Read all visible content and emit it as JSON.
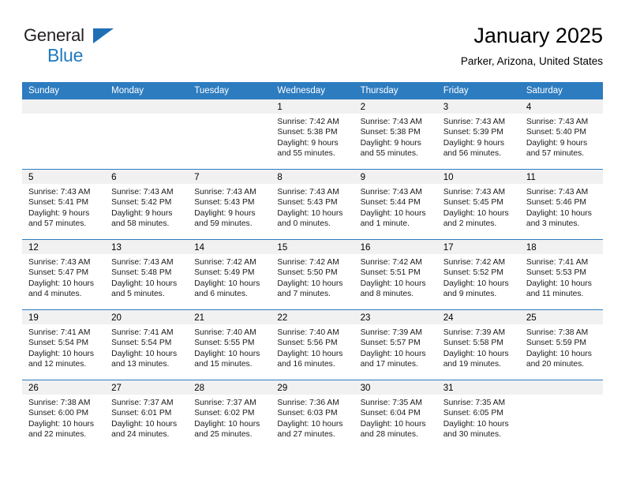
{
  "brand": {
    "line1": "General",
    "line2": "Blue",
    "triangle_color": "#1f6fb5",
    "line2_color": "#1f7ac0"
  },
  "header": {
    "title": "January 2025",
    "subtitle": "Parker, Arizona, United States"
  },
  "theme": {
    "header_blue": "#2d7cc0",
    "day_band_gray": "#f1f1f1",
    "text_color": "#1a1a1a"
  },
  "calendar": {
    "weekdays": [
      "Sunday",
      "Monday",
      "Tuesday",
      "Wednesday",
      "Thursday",
      "Friday",
      "Saturday"
    ],
    "weeks": [
      [
        {
          "day": "",
          "lines": []
        },
        {
          "day": "",
          "lines": []
        },
        {
          "day": "",
          "lines": []
        },
        {
          "day": "1",
          "lines": [
            "Sunrise: 7:42 AM",
            "Sunset: 5:38 PM",
            "Daylight: 9 hours",
            "and 55 minutes."
          ]
        },
        {
          "day": "2",
          "lines": [
            "Sunrise: 7:43 AM",
            "Sunset: 5:38 PM",
            "Daylight: 9 hours",
            "and 55 minutes."
          ]
        },
        {
          "day": "3",
          "lines": [
            "Sunrise: 7:43 AM",
            "Sunset: 5:39 PM",
            "Daylight: 9 hours",
            "and 56 minutes."
          ]
        },
        {
          "day": "4",
          "lines": [
            "Sunrise: 7:43 AM",
            "Sunset: 5:40 PM",
            "Daylight: 9 hours",
            "and 57 minutes."
          ]
        }
      ],
      [
        {
          "day": "5",
          "lines": [
            "Sunrise: 7:43 AM",
            "Sunset: 5:41 PM",
            "Daylight: 9 hours",
            "and 57 minutes."
          ]
        },
        {
          "day": "6",
          "lines": [
            "Sunrise: 7:43 AM",
            "Sunset: 5:42 PM",
            "Daylight: 9 hours",
            "and 58 minutes."
          ]
        },
        {
          "day": "7",
          "lines": [
            "Sunrise: 7:43 AM",
            "Sunset: 5:43 PM",
            "Daylight: 9 hours",
            "and 59 minutes."
          ]
        },
        {
          "day": "8",
          "lines": [
            "Sunrise: 7:43 AM",
            "Sunset: 5:43 PM",
            "Daylight: 10 hours",
            "and 0 minutes."
          ]
        },
        {
          "day": "9",
          "lines": [
            "Sunrise: 7:43 AM",
            "Sunset: 5:44 PM",
            "Daylight: 10 hours",
            "and 1 minute."
          ]
        },
        {
          "day": "10",
          "lines": [
            "Sunrise: 7:43 AM",
            "Sunset: 5:45 PM",
            "Daylight: 10 hours",
            "and 2 minutes."
          ]
        },
        {
          "day": "11",
          "lines": [
            "Sunrise: 7:43 AM",
            "Sunset: 5:46 PM",
            "Daylight: 10 hours",
            "and 3 minutes."
          ]
        }
      ],
      [
        {
          "day": "12",
          "lines": [
            "Sunrise: 7:43 AM",
            "Sunset: 5:47 PM",
            "Daylight: 10 hours",
            "and 4 minutes."
          ]
        },
        {
          "day": "13",
          "lines": [
            "Sunrise: 7:43 AM",
            "Sunset: 5:48 PM",
            "Daylight: 10 hours",
            "and 5 minutes."
          ]
        },
        {
          "day": "14",
          "lines": [
            "Sunrise: 7:42 AM",
            "Sunset: 5:49 PM",
            "Daylight: 10 hours",
            "and 6 minutes."
          ]
        },
        {
          "day": "15",
          "lines": [
            "Sunrise: 7:42 AM",
            "Sunset: 5:50 PM",
            "Daylight: 10 hours",
            "and 7 minutes."
          ]
        },
        {
          "day": "16",
          "lines": [
            "Sunrise: 7:42 AM",
            "Sunset: 5:51 PM",
            "Daylight: 10 hours",
            "and 8 minutes."
          ]
        },
        {
          "day": "17",
          "lines": [
            "Sunrise: 7:42 AM",
            "Sunset: 5:52 PM",
            "Daylight: 10 hours",
            "and 9 minutes."
          ]
        },
        {
          "day": "18",
          "lines": [
            "Sunrise: 7:41 AM",
            "Sunset: 5:53 PM",
            "Daylight: 10 hours",
            "and 11 minutes."
          ]
        }
      ],
      [
        {
          "day": "19",
          "lines": [
            "Sunrise: 7:41 AM",
            "Sunset: 5:54 PM",
            "Daylight: 10 hours",
            "and 12 minutes."
          ]
        },
        {
          "day": "20",
          "lines": [
            "Sunrise: 7:41 AM",
            "Sunset: 5:54 PM",
            "Daylight: 10 hours",
            "and 13 minutes."
          ]
        },
        {
          "day": "21",
          "lines": [
            "Sunrise: 7:40 AM",
            "Sunset: 5:55 PM",
            "Daylight: 10 hours",
            "and 15 minutes."
          ]
        },
        {
          "day": "22",
          "lines": [
            "Sunrise: 7:40 AM",
            "Sunset: 5:56 PM",
            "Daylight: 10 hours",
            "and 16 minutes."
          ]
        },
        {
          "day": "23",
          "lines": [
            "Sunrise: 7:39 AM",
            "Sunset: 5:57 PM",
            "Daylight: 10 hours",
            "and 17 minutes."
          ]
        },
        {
          "day": "24",
          "lines": [
            "Sunrise: 7:39 AM",
            "Sunset: 5:58 PM",
            "Daylight: 10 hours",
            "and 19 minutes."
          ]
        },
        {
          "day": "25",
          "lines": [
            "Sunrise: 7:38 AM",
            "Sunset: 5:59 PM",
            "Daylight: 10 hours",
            "and 20 minutes."
          ]
        }
      ],
      [
        {
          "day": "26",
          "lines": [
            "Sunrise: 7:38 AM",
            "Sunset: 6:00 PM",
            "Daylight: 10 hours",
            "and 22 minutes."
          ]
        },
        {
          "day": "27",
          "lines": [
            "Sunrise: 7:37 AM",
            "Sunset: 6:01 PM",
            "Daylight: 10 hours",
            "and 24 minutes."
          ]
        },
        {
          "day": "28",
          "lines": [
            "Sunrise: 7:37 AM",
            "Sunset: 6:02 PM",
            "Daylight: 10 hours",
            "and 25 minutes."
          ]
        },
        {
          "day": "29",
          "lines": [
            "Sunrise: 7:36 AM",
            "Sunset: 6:03 PM",
            "Daylight: 10 hours",
            "and 27 minutes."
          ]
        },
        {
          "day": "30",
          "lines": [
            "Sunrise: 7:35 AM",
            "Sunset: 6:04 PM",
            "Daylight: 10 hours",
            "and 28 minutes."
          ]
        },
        {
          "day": "31",
          "lines": [
            "Sunrise: 7:35 AM",
            "Sunset: 6:05 PM",
            "Daylight: 10 hours",
            "and 30 minutes."
          ]
        },
        {
          "day": "",
          "lines": []
        }
      ]
    ]
  }
}
